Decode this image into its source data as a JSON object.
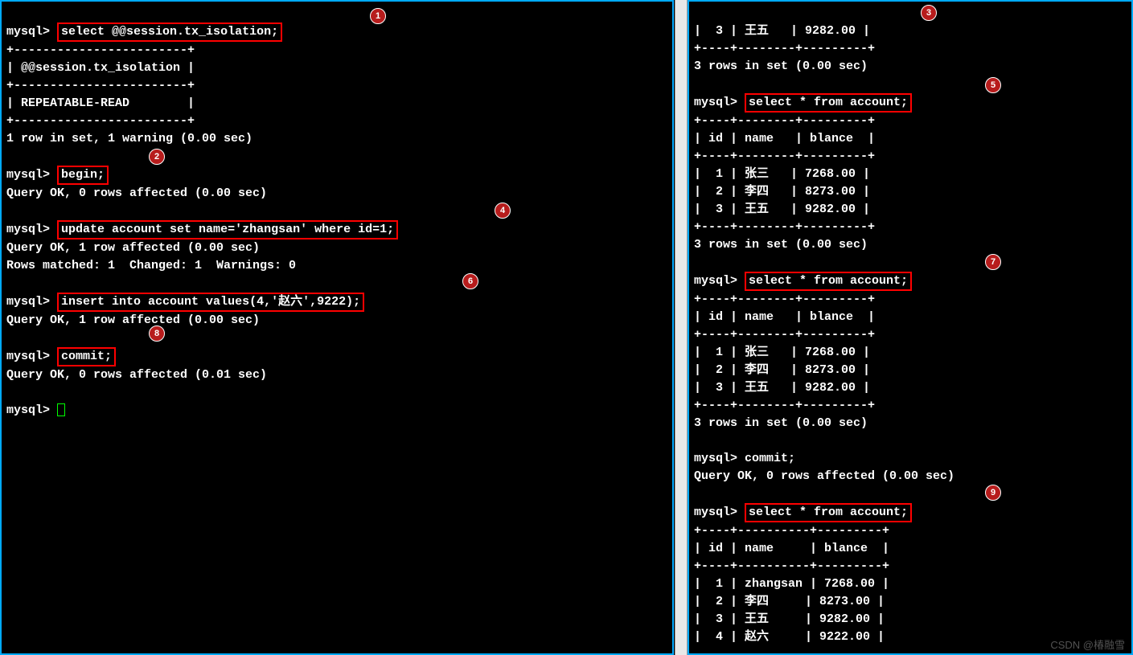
{
  "prompt": "mysql>",
  "left": {
    "cmd1": "select @@session.tx_isolation;",
    "sep1": "+------------------------+",
    "hdr1": "| @@session.tx_isolation |",
    "row1": "| REPEATABLE-READ        |",
    "res1": "1 row in set, 1 warning (0.00 sec)",
    "cmd2": "begin;",
    "res2": "Query OK, 0 rows affected (0.00 sec)",
    "cmd3": "update account set name='zhangsan' where id=1;",
    "res3a": "Query OK, 1 row affected (0.00 sec)",
    "res3b": "Rows matched: 1  Changed: 1  Warnings: 0",
    "cmd4": "insert into account values(4,'赵六',9222);",
    "res4": "Query OK, 1 row affected (0.00 sec)",
    "cmd5": "commit;",
    "res5": "Query OK, 0 rows affected (0.01 sec)"
  },
  "right": {
    "top_row": "|  3 | 王五   | 9282.00 |",
    "top_sep": "+----+--------+---------+",
    "rows_msg": "3 rows in set (0.00 sec)",
    "sel": "select * from account;",
    "t1_sep": "+----+--------+---------+",
    "t1_hdr": "| id | name   | blance  |",
    "t1_r1": "|  1 | 张三   | 7268.00 |",
    "t1_r2": "|  2 | 李四   | 8273.00 |",
    "t1_r3": "|  3 | 王五   | 9282.00 |",
    "commit": "commit;",
    "commit_res": "Query OK, 0 rows affected (0.00 sec)",
    "t2_sep": "+----+----------+---------+",
    "t2_hdr": "| id | name     | blance  |",
    "t2_r1": "|  1 | zhangsan | 7268.00 |",
    "t2_r2": "|  2 | 李四     | 8273.00 |",
    "t2_r3": "|  3 | 王五     | 9282.00 |",
    "t2_r4": "|  4 | 赵六     | 9222.00 |"
  },
  "badges": {
    "b1": "1",
    "b2": "2",
    "b3": "3",
    "b4": "4",
    "b5": "5",
    "b6": "6",
    "b7": "7",
    "b8": "8",
    "b9": "9"
  },
  "watermark": "CSDN @椿融雪"
}
